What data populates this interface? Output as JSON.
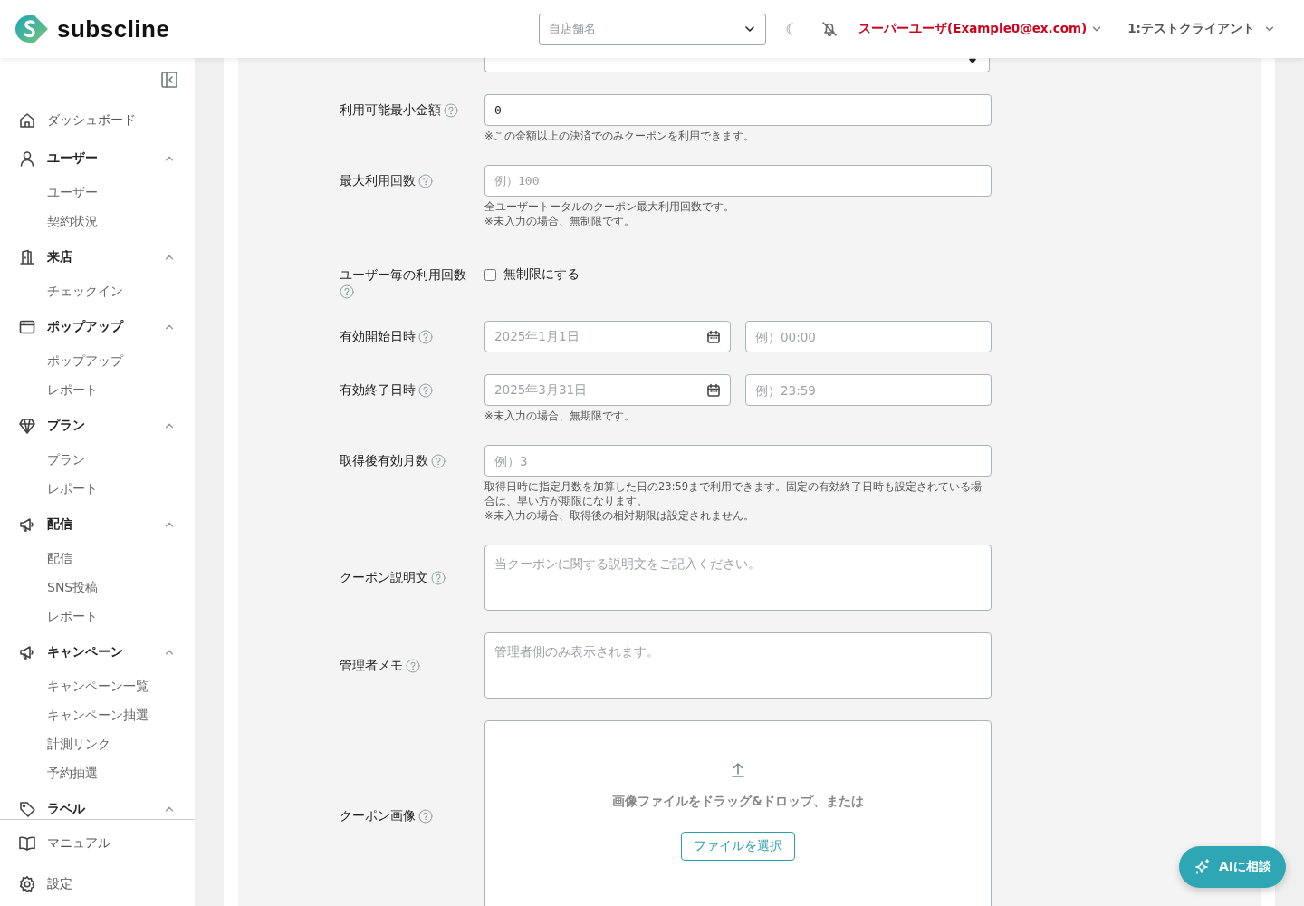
{
  "header": {
    "logo": "subscline",
    "store_select": {
      "placeholder": "自店舗名"
    },
    "user_menu": "スーパーユーザ(Example0@ex.com)",
    "client_menu": "1:テストクライアント"
  },
  "sidebar": {
    "items": [
      {
        "label": "ダッシュボード"
      },
      {
        "label": "ユーザー",
        "expanded": true,
        "children": [
          {
            "label": "ユーザー"
          },
          {
            "label": "契約状況"
          }
        ]
      },
      {
        "label": "来店",
        "expanded": true,
        "children": [
          {
            "label": "チェックイン"
          }
        ]
      },
      {
        "label": "ポップアップ",
        "expanded": true,
        "children": [
          {
            "label": "ポップアップ"
          },
          {
            "label": "レポート"
          }
        ]
      },
      {
        "label": "プラン",
        "expanded": true,
        "children": [
          {
            "label": "プラン"
          },
          {
            "label": "レポート"
          }
        ]
      },
      {
        "label": "配信",
        "expanded": true,
        "children": [
          {
            "label": "配信"
          },
          {
            "label": "SNS投稿"
          },
          {
            "label": "レポート"
          }
        ]
      },
      {
        "label": "キャンペーン",
        "expanded": true,
        "children": [
          {
            "label": "キャンペーン一覧"
          },
          {
            "label": "キャンペーン抽選"
          },
          {
            "label": "計測リンク"
          },
          {
            "label": "予約抽選"
          }
        ]
      },
      {
        "label": "ラベル",
        "expanded": true
      }
    ],
    "bottom_items": [
      {
        "label": "マニュアル"
      },
      {
        "label": "設定"
      }
    ]
  },
  "form": {
    "rows": [
      {
        "kind": "number",
        "label": "利用可能最小金額",
        "value": "0",
        "hints": [
          "※この金額以上の決済でのみクーポンを利用できます。"
        ]
      },
      {
        "kind": "number",
        "label": "最大利用回数",
        "placeholder": "例）100",
        "hints": [
          "全ユーザートータルのクーポン最大利用回数です。",
          "※未入力の場合、無制限です。"
        ]
      },
      {
        "kind": "checkbox",
        "label": "ユーザー毎の利用回数",
        "checkbox": {
          "label": "無制限にする",
          "checked": false
        }
      },
      {
        "kind": "datetime",
        "label": "有効開始日時",
        "date_placeholder": "2025年1月1日",
        "time_placeholder": "例）00:00"
      },
      {
        "kind": "datetime",
        "label": "有効終了日時",
        "date_placeholder": "2025年3月31日",
        "time_placeholder": "例）23:59",
        "hints": [
          "※未入力の場合、無期限です。"
        ]
      },
      {
        "kind": "text",
        "label": "取得後有効月数",
        "placeholder": "例）3",
        "hints": [
          "取得日時に指定月数を加算した日の23:59まで利用できます。固定の有効終了日時も設定されている場合は、早い方が期限になります。",
          "※未入力の場合、取得後の相対期限は設定されません。"
        ]
      },
      {
        "kind": "textarea",
        "label": "クーポン説明文",
        "placeholder": "当クーポンに関する説明文をご記入ください。"
      },
      {
        "kind": "textarea",
        "label": "管理者メモ",
        "placeholder": "管理者側のみ表示されます。"
      },
      {
        "kind": "upload",
        "label": "クーポン画像",
        "drop_text": "画像ファイルをドラッグ&ドロップ、または",
        "button": "ファイルを選択"
      }
    ]
  },
  "ai_button": "AIに相談"
}
